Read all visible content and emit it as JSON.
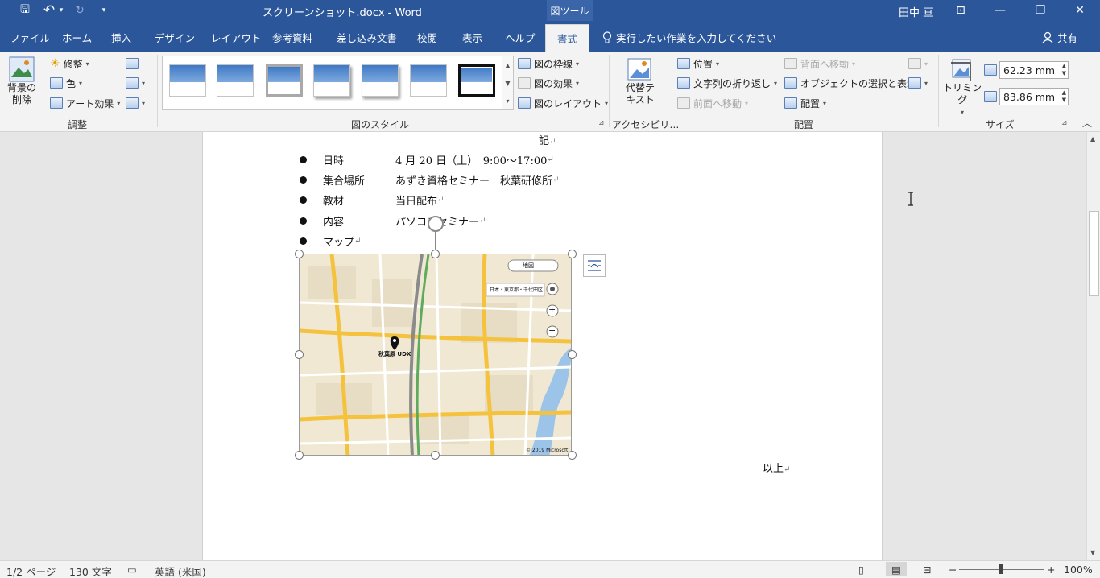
{
  "titlebar": {
    "doc_title": "スクリーンショット.docx - Word",
    "tool_context": "図ツール",
    "user": "田中 亘",
    "qat_icons": [
      "save-icon",
      "undo-icon",
      "redo-icon",
      "customize-icon"
    ],
    "win_icons": [
      "ribbon-display-icon",
      "minimize-icon",
      "restore-icon",
      "close-icon"
    ],
    "glyphs": {
      "save": "🖫",
      "undo": "↶",
      "undo_caret": "▾",
      "redo": "↻",
      "customize": "▾",
      "ribbon_display": "⊡",
      "minimize": "—",
      "restore": "❐",
      "close": "✕"
    }
  },
  "tabs": [
    "ファイル",
    "ホーム",
    "挿入",
    "デザイン",
    "レイアウト",
    "参考資料",
    "差し込み文書",
    "校閲",
    "表示",
    "ヘルプ",
    "書式"
  ],
  "active_tab": "書式",
  "tell_me": "実行したい作業を入力してください",
  "share": "共有",
  "ribbon": {
    "adjust": {
      "remove_bg_line1": "背景の",
      "remove_bg_line2": "削除",
      "corrections": "修整",
      "color": "色",
      "artistic": "アート効果",
      "group_label": "調整"
    },
    "styles": {
      "border": "図の枠線",
      "effects": "図の効果",
      "layout": "図のレイアウト",
      "group_label": "図のスタイル"
    },
    "accessibility": {
      "alt_text_line1": "代替テ",
      "alt_text_line2": "キスト",
      "group_label": "アクセシビリ…"
    },
    "arrange": {
      "position": "位置",
      "wrap": "文字列の折り返し",
      "bring_forward": "前面へ移動",
      "send_backward": "背面へ移動",
      "selection_pane": "オブジェクトの選択と表示",
      "align": "配置",
      "group_label": "配置"
    },
    "size": {
      "crop": "トリミング",
      "height": "62.23 mm",
      "width": "83.86 mm",
      "group_label": "サイズ"
    },
    "glyphs": {
      "caret": "▾",
      "launcher": "⊿",
      "collapse": "︿",
      "sun": "☀",
      "scroll_up": "▲",
      "scroll_down": "▼",
      "gallery_more": "▾",
      "spin_up": "▲",
      "spin_down": "▼"
    }
  },
  "document": {
    "ki": "記",
    "para_mark": "↵",
    "rows": [
      {
        "label": "日時",
        "value": "4 月 20 日（土）　9:00～17:00"
      },
      {
        "label": "集合場所",
        "value": "あずき資格セミナー　秋葉研修所"
      },
      {
        "label": "教材",
        "value": "当日配布"
      },
      {
        "label": "内容",
        "value": "パソコンセミナー"
      },
      {
        "label": "マップ",
        "value": ""
      }
    ],
    "ijo": "以上",
    "map": {
      "type_select": "地図",
      "search_box": "日本・東京都・千代田区",
      "landmark": "秋葉原 UDX",
      "copyright": "© 2019 Microsoft",
      "zoom_in": "+",
      "zoom_out": "−"
    }
  },
  "statusbar": {
    "page": "1/2 ページ",
    "words": "130 文字",
    "language": "英語 (米国)",
    "zoom": "100%",
    "zoom_minus": "−",
    "zoom_plus": "+",
    "proof_glyph": "▭",
    "view_glyphs": [
      "▯",
      "▤",
      "⊟"
    ]
  },
  "colors": {
    "accent": "#2b579a",
    "ribbon_bg": "#f3f3f3",
    "doc_bg": "#e6e6e6"
  }
}
